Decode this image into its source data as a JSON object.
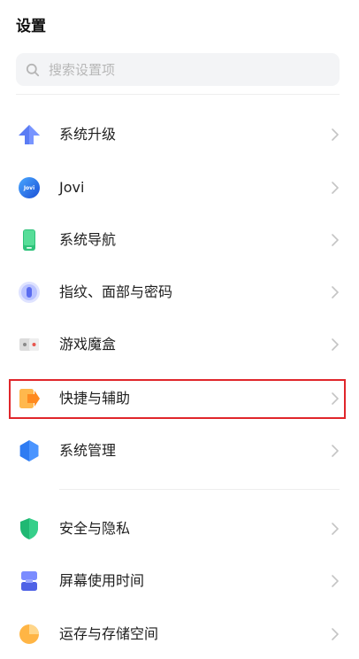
{
  "header": {
    "title": "设置"
  },
  "search": {
    "placeholder": "搜索设置项"
  },
  "items": [
    {
      "label": "系统升级",
      "icon": "arrow-up-icon"
    },
    {
      "label": "Jovi",
      "icon": "jovi-icon",
      "icon_text": "Jovi"
    },
    {
      "label": "系统导航",
      "icon": "phone-icon"
    },
    {
      "label": "指纹、面部与密码",
      "icon": "fingerprint-icon"
    },
    {
      "label": "游戏魔盒",
      "icon": "game-box-icon"
    },
    {
      "label": "快捷与辅助",
      "icon": "shortcut-icon"
    },
    {
      "label": "系统管理",
      "icon": "hexagon-icon"
    },
    {
      "label": "安全与隐私",
      "icon": "shield-icon"
    },
    {
      "label": "屏幕使用时间",
      "icon": "hourglass-icon"
    },
    {
      "label": "运存与存储空间",
      "icon": "pie-chart-icon"
    }
  ],
  "colors": {
    "highlight": "#e0262b",
    "chevron": "#c4c4c4"
  }
}
